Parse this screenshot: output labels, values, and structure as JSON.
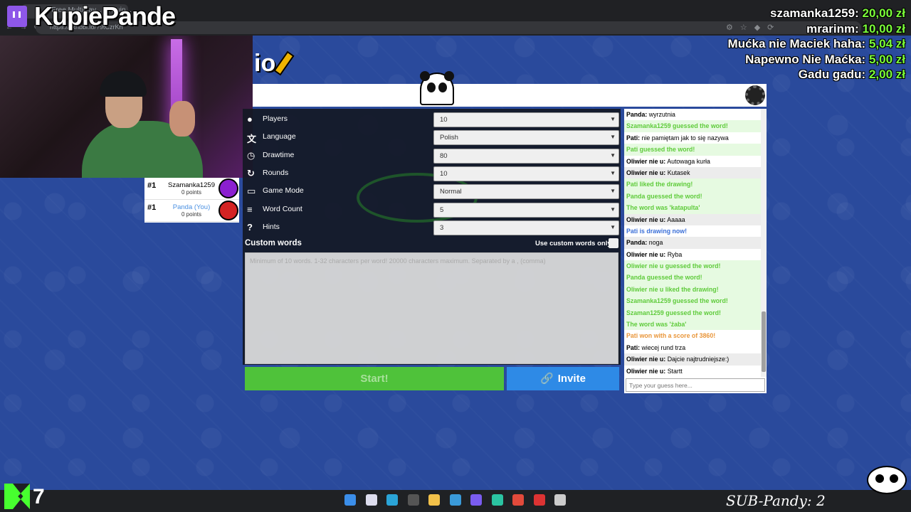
{
  "stream": {
    "channel_name": "KupiePande",
    "donations": [
      {
        "name": "szamanka1259:",
        "amount": "20,00 zł"
      },
      {
        "name": "mrarinm:",
        "amount": "10,00 zł"
      },
      {
        "name": "Mućka nie Maciek haha:",
        "amount": "5,04 zł"
      },
      {
        "name": "Napewno Nie Maćka:",
        "amount": "5,00 zł"
      },
      {
        "name": "Gadu gadu:",
        "amount": "2,00 zł"
      }
    ],
    "k_count": "7",
    "sub_counter": "SUB-Pandy: 2"
  },
  "browser": {
    "tab_title": "s... - Free Multiplay... Drawin...",
    "address": "https://skribbl.io/?9tCzrKrf"
  },
  "game": {
    "logo": "io",
    "players": [
      {
        "rank": "#1",
        "name": "Szamanka1259",
        "points": "0 points",
        "you": false,
        "avatar_color": "#8b1fd0"
      },
      {
        "rank": "#1",
        "name": "Panda (You)",
        "points": "0 points",
        "you": true,
        "avatar_color": "#d42323"
      }
    ],
    "settings": [
      {
        "label": "Players",
        "value": "10",
        "icon": "person-icon"
      },
      {
        "label": "Language",
        "value": "Polish",
        "icon": "language-icon"
      },
      {
        "label": "Drawtime",
        "value": "80",
        "icon": "clock-icon"
      },
      {
        "label": "Rounds",
        "value": "10",
        "icon": "rounds-icon"
      },
      {
        "label": "Game Mode",
        "value": "Normal",
        "icon": "gamemode-icon"
      },
      {
        "label": "Word Count",
        "value": "5",
        "icon": "wordcount-icon"
      },
      {
        "label": "Hints",
        "value": "3",
        "icon": "hint-icon"
      }
    ],
    "custom_words_label": "Custom words",
    "custom_only_label": "Use custom words only",
    "custom_words_placeholder": "Minimum of 10 words. 1-32 characters per word! 20000 characters maximum. Separated by a , (comma)",
    "start_label": "Start!",
    "invite_label": "Invite"
  },
  "chat": {
    "messages": [
      {
        "author": "Panda:",
        "text": "wyrzutnia",
        "style": "normal"
      },
      {
        "author": "",
        "text": "Szamanka1259 guessed the word!",
        "style": "green"
      },
      {
        "author": "Pati:",
        "text": "nie pamiętam jak to się nazywa",
        "style": "normal"
      },
      {
        "author": "",
        "text": "Pati guessed the word!",
        "style": "green"
      },
      {
        "author": "Oliwier nie u:",
        "text": "Autowaga kurła",
        "style": "normal"
      },
      {
        "author": "Oliwier nie u:",
        "text": "Kutasek",
        "style": "normal"
      },
      {
        "author": "",
        "text": "Pati liked the drawing!",
        "style": "green"
      },
      {
        "author": "",
        "text": "Panda guessed the word!",
        "style": "green"
      },
      {
        "author": "",
        "text": "The word was 'katapulta'",
        "style": "green"
      },
      {
        "author": "Oliwier nie u:",
        "text": "Aaaaa",
        "style": "normal"
      },
      {
        "author": "",
        "text": "Pati is drawing now!",
        "style": "blue"
      },
      {
        "author": "Panda:",
        "text": "noga",
        "style": "normal"
      },
      {
        "author": "Oliwier nie u:",
        "text": "Ryba",
        "style": "normal"
      },
      {
        "author": "",
        "text": "Oliwier nie u guessed the word!",
        "style": "green"
      },
      {
        "author": "",
        "text": "Panda guessed the word!",
        "style": "green"
      },
      {
        "author": "",
        "text": "Oliwier nie u liked the drawing!",
        "style": "green"
      },
      {
        "author": "",
        "text": "Szamanka1259 guessed the word!",
        "style": "green"
      },
      {
        "author": "",
        "text": "Szaman1259 guessed the word!",
        "style": "green"
      },
      {
        "author": "",
        "text": "The word was 'żaba'",
        "style": "green"
      },
      {
        "author": "",
        "text": "Pati won with a score of 3860!",
        "style": "orange"
      },
      {
        "author": "Pati:",
        "text": "wiecej rund trza",
        "style": "normal"
      },
      {
        "author": "Oliwier nie u:",
        "text": "Dajcie najtrudniejsze:)",
        "style": "normal"
      },
      {
        "author": "Oliwier nie u:",
        "text": "Startt",
        "style": "normal"
      }
    ],
    "input_placeholder": "Type your guess here..."
  }
}
